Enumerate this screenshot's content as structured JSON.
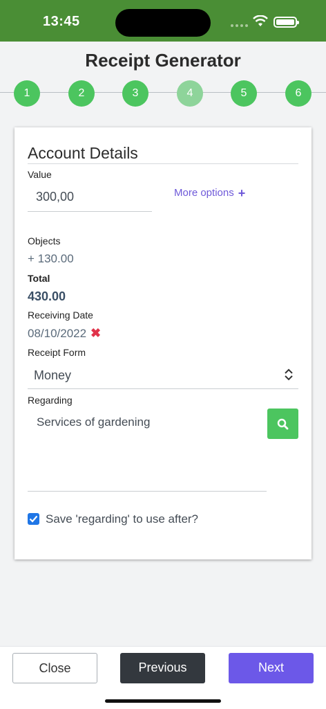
{
  "status_bar": {
    "time": "13:45"
  },
  "header": {
    "title": "Receipt Generator"
  },
  "stepper": {
    "steps": [
      "1",
      "2",
      "3",
      "4",
      "5",
      "6"
    ],
    "active_index": 3
  },
  "card": {
    "title": "Account Details",
    "value_label": "Value",
    "value": "300,00",
    "more_options_label": "More options",
    "objects_label": "Objects",
    "objects_value": "+ 130.00",
    "total_label": "Total",
    "total_value": "430.00",
    "receiving_date_label": "Receiving Date",
    "receiving_date": "08/10/2022",
    "receipt_form_label": "Receipt Form",
    "receipt_form_value": "Money",
    "regarding_label": "Regarding",
    "regarding_value": "Services of gardening",
    "save_regarding_label": "Save 'regarding' to use after?",
    "save_regarding_checked": true
  },
  "footer": {
    "close_label": "Close",
    "previous_label": "Previous",
    "next_label": "Next"
  },
  "colors": {
    "status_bar": "#4a8e35",
    "step": "#4cc55f",
    "step_active": "#8ed49a",
    "accent_purple": "#6c58e8",
    "dark_button": "#33383e",
    "delete_red": "#e0334a",
    "checkbox_blue": "#1f76e6"
  }
}
